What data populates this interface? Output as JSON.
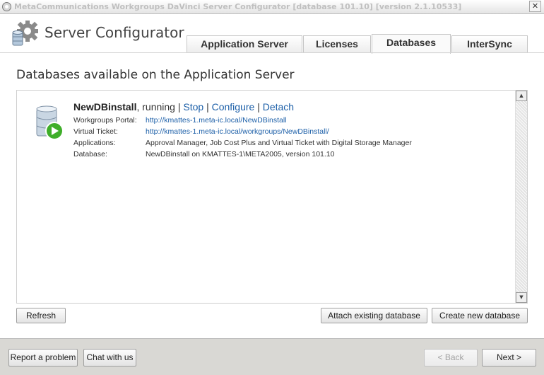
{
  "window": {
    "title": "MetaCommunications Workgroups DaVinci Server Configurator [database 101.10] [version 2.1.10533]",
    "close_glyph": "✕"
  },
  "header": {
    "app_name": "Server Configurator",
    "logo_icon": "gear-database-icon"
  },
  "tabs": [
    {
      "label": "Application Server",
      "active": false
    },
    {
      "label": "Licenses",
      "active": false
    },
    {
      "label": "Databases",
      "active": true
    },
    {
      "label": "InterSync",
      "active": false
    }
  ],
  "main": {
    "section_title": "Databases available on the Application Server",
    "databases": [
      {
        "icon": "database-running-icon",
        "name": "NewDBinstall",
        "status": ", running",
        "separator": "|",
        "actions": {
          "stop": "Stop",
          "configure": "Configure",
          "detach": "Detach"
        },
        "details": [
          {
            "label": "Workgroups Portal:",
            "value": "http://kmattes-1.meta-ic.local/NewDBinstall",
            "link": true
          },
          {
            "label": "Virtual Ticket:",
            "value": "http://kmattes-1.meta-ic.local/workgroups/NewDBinstall/",
            "link": true
          },
          {
            "label": "Applications:",
            "value": "Approval Manager, Job Cost Plus and Virtual Ticket with Digital Storage Manager",
            "link": false
          },
          {
            "label": "Database:",
            "value": "NewDBinstall on KMATTES-1\\META2005, version 101.10",
            "link": false
          }
        ]
      }
    ],
    "scroll_up_glyph": "▲",
    "scroll_down_glyph": "▼"
  },
  "buttons": {
    "refresh": "Refresh",
    "attach": "Attach existing database",
    "create": "Create new database"
  },
  "footer": {
    "report": "Report a problem",
    "chat": "Chat with us",
    "back": "< Back",
    "next": "Next >"
  },
  "colors": {
    "link": "#1c5fa8",
    "play_green": "#3fae2a",
    "footer_bg": "#d9d8d4"
  }
}
